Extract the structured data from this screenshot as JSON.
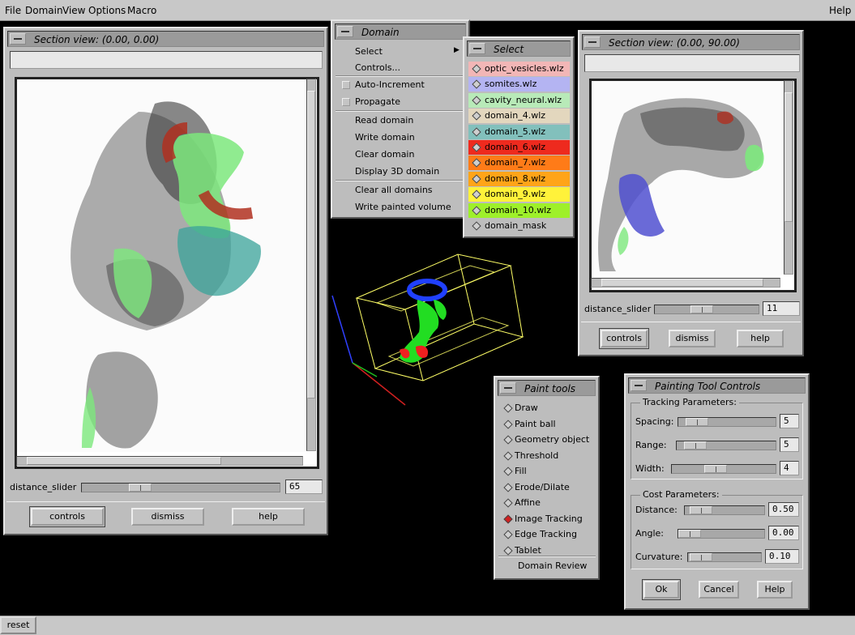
{
  "menubar": {
    "file": "File",
    "domain": "Domain",
    "view": "View",
    "options": "Options",
    "macro": "Macro",
    "help": "Help"
  },
  "section_view_1": {
    "title": "Section view: (0.00, 0.00)",
    "slider_label": "distance_slider",
    "slider_value": "65",
    "controls_label": "controls",
    "dismiss_label": "dismiss",
    "help_label": "help"
  },
  "section_view_2": {
    "title": "Section view: (0.00, 90.00)",
    "slider_label": "distance_slider",
    "slider_value": "11",
    "controls_label": "controls",
    "dismiss_label": "dismiss",
    "help_label": "help"
  },
  "domain_menu": {
    "title": "Domain",
    "items": [
      "Select",
      "Controls...",
      "Auto-Increment",
      "Propagate",
      "Read domain",
      "Write domain",
      "Clear domain",
      "Display 3D domain",
      "Clear all domains",
      "Write painted volume"
    ]
  },
  "select_menu": {
    "title": "Select",
    "items": [
      {
        "label": "optic_vesicles.wlz",
        "color": "#f2b6b6"
      },
      {
        "label": "somites.wlz",
        "color": "#b4b4f2"
      },
      {
        "label": "cavity_neural.wlz",
        "color": "#b8eab8"
      },
      {
        "label": "domain_4.wlz",
        "color": "#e3d7be"
      },
      {
        "label": "domain_5.wlz",
        "color": "#82c0bc"
      },
      {
        "label": "domain_6.wlz",
        "color": "#ee2a1e"
      },
      {
        "label": "domain_7.wlz",
        "color": "#ff7b18"
      },
      {
        "label": "domain_8.wlz",
        "color": "#ffa418"
      },
      {
        "label": "domain_9.wlz",
        "color": "#fff23a"
      },
      {
        "label": "domain_10.wlz",
        "color": "#9ef02a"
      },
      {
        "label": "domain_mask",
        "color": "#bdbdbd"
      }
    ]
  },
  "paint_tools": {
    "title": "Paint tools",
    "items": [
      "Draw",
      "Paint ball",
      "Geometry object",
      "Threshold",
      "Fill",
      "Erode/Dilate",
      "Affine",
      "Image Tracking",
      "Edge Tracking",
      "Tablet"
    ],
    "selected": "Image Tracking",
    "review_label": "Domain Review"
  },
  "tool_controls": {
    "title": "Painting Tool Controls",
    "tracking_title": "Tracking Parameters:",
    "spacing_label": "Spacing:",
    "spacing_value": "5",
    "spacing_level": 0.1,
    "range_label": "Range:",
    "range_value": "5",
    "range_level": 0.1,
    "width_label": "Width:",
    "width_value": "4",
    "width_level": 0.4,
    "cost_title": "Cost Parameters:",
    "distance_label": "Distance:",
    "distance_value": "0.50",
    "angle_label": "Angle:",
    "angle_value": "0.00",
    "curvature_label": "Curvature:",
    "curvature_value": "0.10",
    "ok_label": "Ok",
    "cancel_label": "Cancel",
    "help_label": "Help"
  },
  "statusbar": {
    "reset_label": "reset"
  }
}
